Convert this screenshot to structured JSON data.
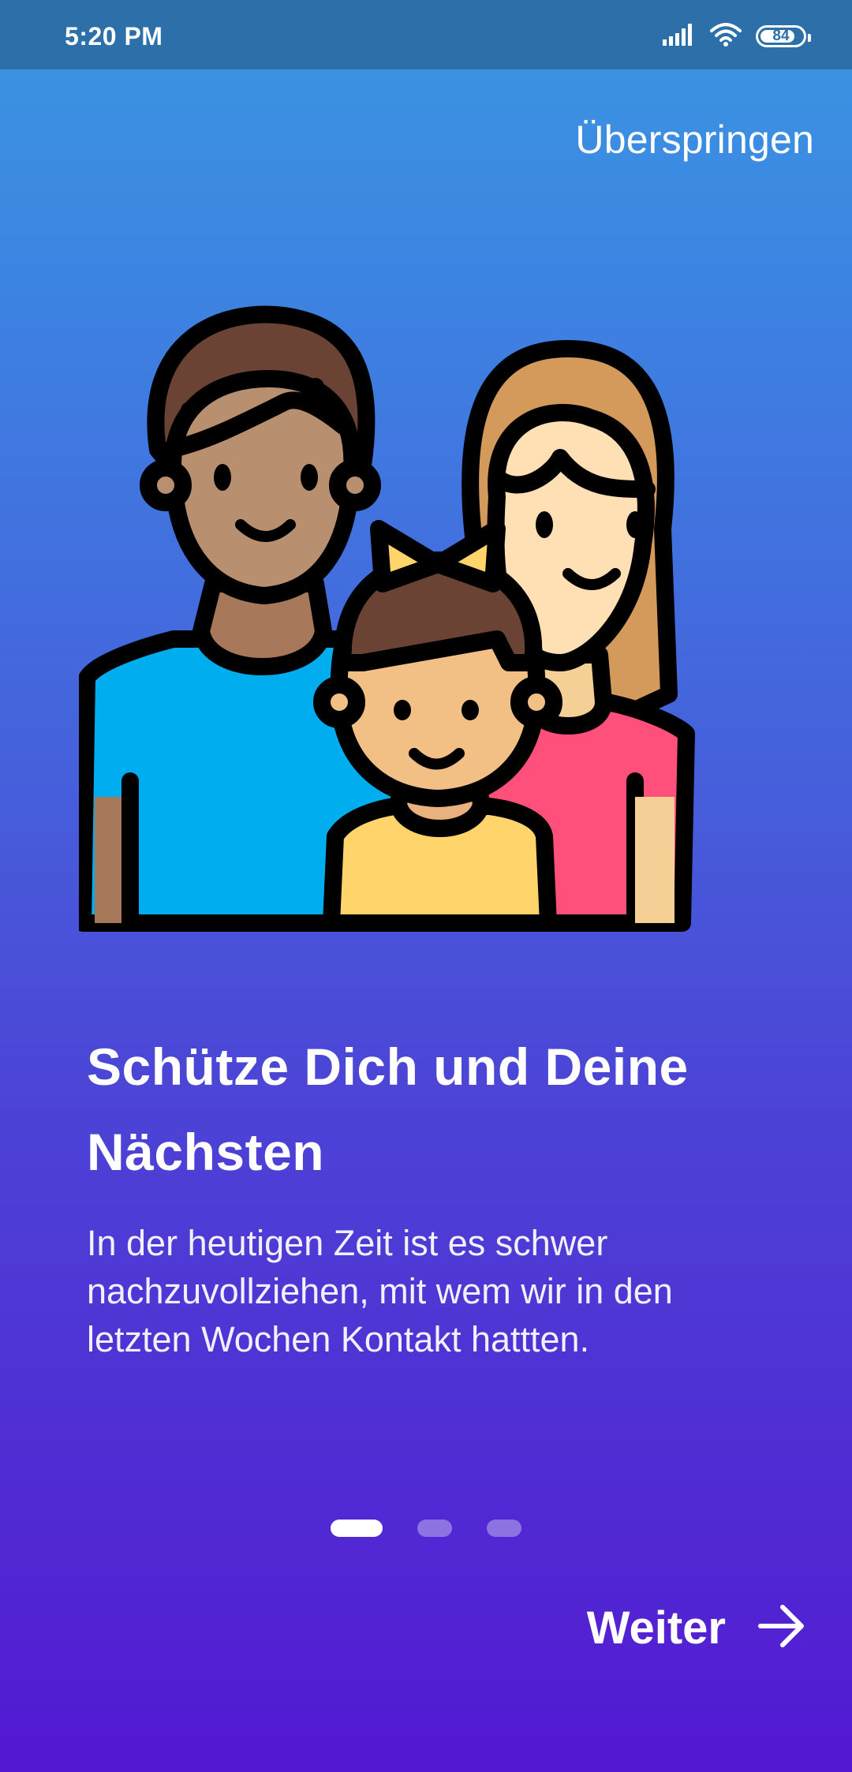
{
  "status_bar": {
    "time": "5:20 PM",
    "battery_level": "84",
    "battery_fraction": 0.84,
    "icons": [
      "signal-icon",
      "wifi-icon",
      "battery-icon"
    ]
  },
  "onboarding": {
    "skip_label": "Überspringen",
    "illustration": "family-illustration",
    "title": "Schütze Dich und Deine Nächsten",
    "description": "In der heutigen Zeit ist es schwer nachzuvollziehen, mit wem wir in den letzten Wochen Kontakt hattten.",
    "pager": {
      "total_pages": 3,
      "current_page": 1
    },
    "next_label": "Weiter",
    "next_icon": "arrow-right-icon"
  },
  "colors": {
    "gradient_top": "#3a96e2",
    "gradient_bottom": "#5319d2",
    "status_bar": "#2d6fa8",
    "text": "#ffffff"
  }
}
